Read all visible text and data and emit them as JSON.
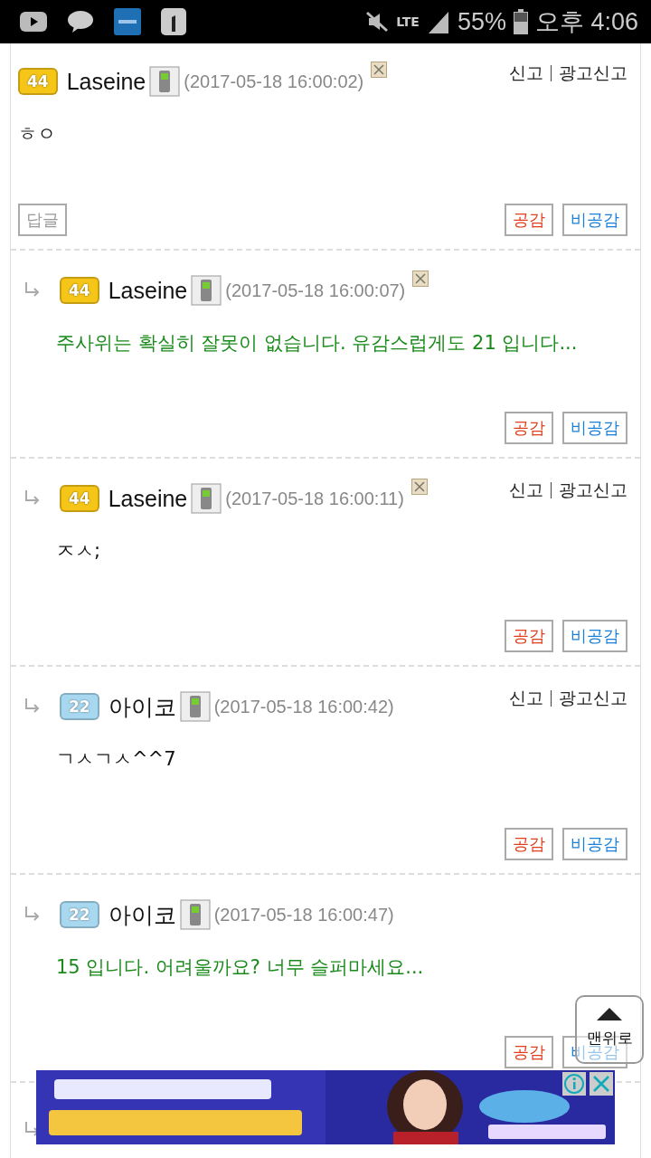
{
  "status_bar": {
    "network": "LTE",
    "battery": "55%",
    "time": "오후 4:06"
  },
  "comments": [
    {
      "reply": false,
      "level": "44",
      "color": "#f5c518",
      "name": "Laseine",
      "date": "(2017-05-18 16:00:02)",
      "deletable": true,
      "report": "신고",
      "ad_report": "광고신고",
      "text": "ㅎㅇ",
      "highlighted": false,
      "reply_button": "답글",
      "like": "공감",
      "dislike": "비공감"
    },
    {
      "reply": true,
      "level": "44",
      "color": "#f5c518",
      "name": "Laseine",
      "date": "(2017-05-18 16:00:07)",
      "deletable": true,
      "text": "주사위는 확실히 잘못이 없습니다. 유감스럽게도 21 입니다...",
      "highlighted": true,
      "like": "공감",
      "dislike": "비공감"
    },
    {
      "reply": true,
      "level": "44",
      "color": "#f5c518",
      "name": "Laseine",
      "date": "(2017-05-18 16:00:11)",
      "deletable": true,
      "report": "신고",
      "ad_report": "광고신고",
      "text": "ㅈㅅ;",
      "highlighted": false,
      "like": "공감",
      "dislike": "비공감"
    },
    {
      "reply": true,
      "level": "22",
      "color": "#a8d8f0",
      "name": "아이코",
      "date": "(2017-05-18 16:00:42)",
      "deletable": false,
      "report": "신고",
      "ad_report": "광고신고",
      "text": "ㄱㅅㄱㅅ^^7",
      "highlighted": false,
      "like": "공감",
      "dislike": "비공감"
    },
    {
      "reply": true,
      "level": "22",
      "color": "#a8d8f0",
      "name": "아이코",
      "date": "(2017-05-18 16:00:47)",
      "deletable": false,
      "text": "15 입니다. 어려울까요? 너무 슬퍼마세요...",
      "highlighted": true,
      "like": "공감",
      "dislike": "비공감"
    }
  ],
  "next_comment_reply": true,
  "top_button": "맨위로"
}
